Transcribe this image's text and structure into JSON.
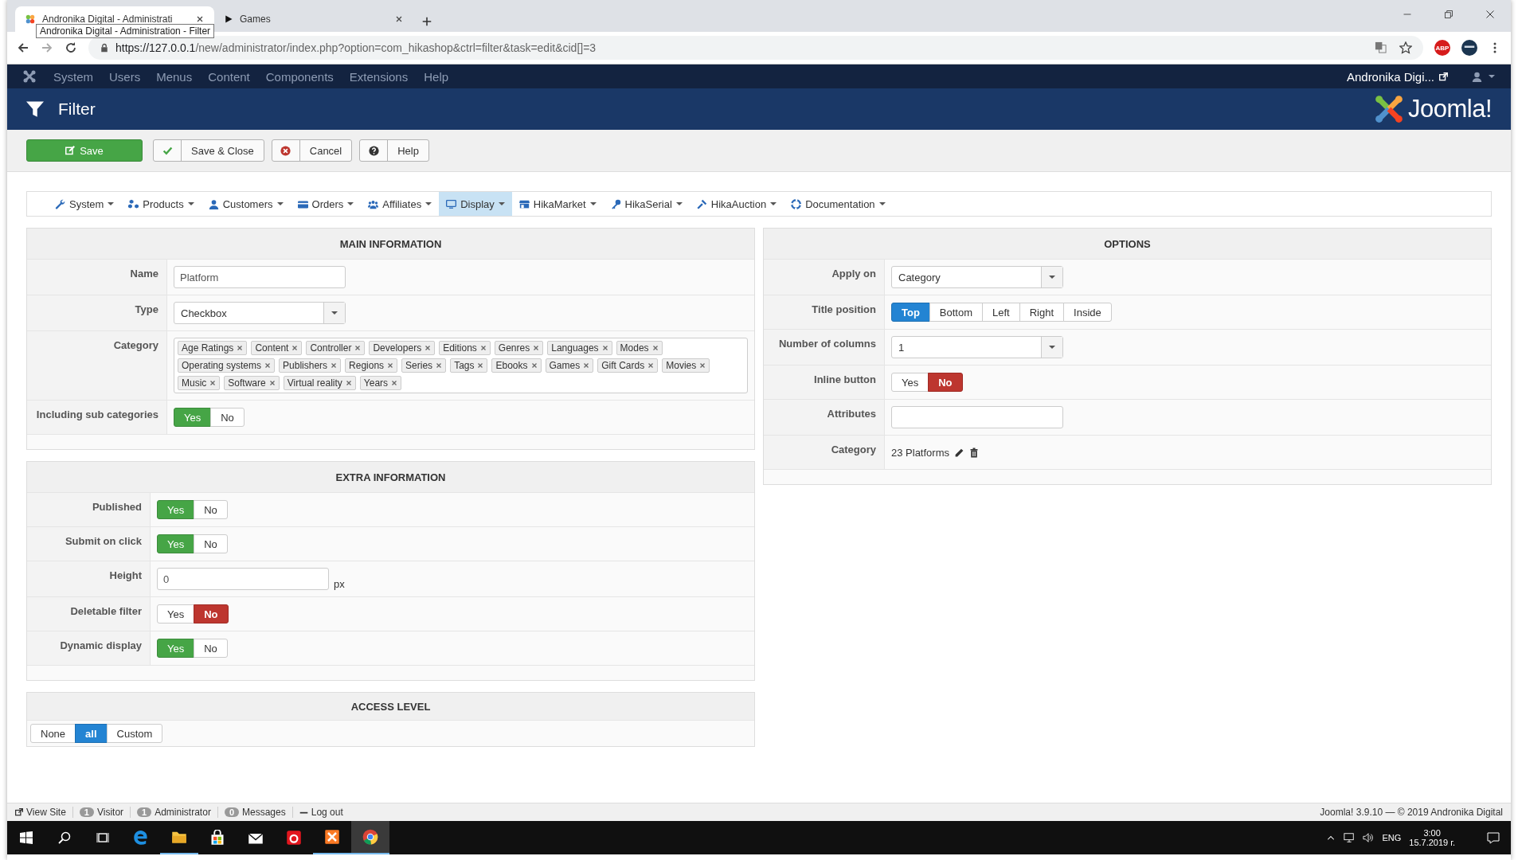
{
  "browser": {
    "tabs": [
      {
        "title": "Andronika Digital - Administrati",
        "selected": true,
        "kind": "site"
      },
      {
        "title": "Games",
        "selected": false,
        "kind": "media"
      }
    ],
    "tooltip": "Andronika Digital - Administration - Filter",
    "extension_badge": "ABP",
    "url_host": "https://127.0.0.1",
    "url_path": "/new/administrator/index.php?option=com_hikashop&ctrl=filter&task=edit&cid[]=3"
  },
  "admin_menu": {
    "items": [
      "System",
      "Users",
      "Menus",
      "Content",
      "Components",
      "Extensions",
      "Help"
    ],
    "site_link": "Andronika Digi..."
  },
  "header": {
    "title": "Filter",
    "logo_text": "Joomla!"
  },
  "toolbar": [
    {
      "label": "Save",
      "kind": "save"
    },
    {
      "label": "Save & Close",
      "kind": "check"
    },
    {
      "label": "Cancel",
      "kind": "cancel"
    },
    {
      "label": "Help",
      "kind": "help"
    }
  ],
  "submenu": [
    {
      "label": "System",
      "kind": "wrench",
      "selected": false
    },
    {
      "label": "Products",
      "kind": "cubes",
      "selected": false
    },
    {
      "label": "Customers",
      "kind": "user",
      "selected": false
    },
    {
      "label": "Orders",
      "kind": "card",
      "selected": false
    },
    {
      "label": "Affiliates",
      "kind": "users",
      "selected": false
    },
    {
      "label": "Display",
      "kind": "monitor",
      "selected": true
    },
    {
      "label": "HikaMarket",
      "kind": "store",
      "selected": false
    },
    {
      "label": "HikaSerial",
      "kind": "key",
      "selected": false
    },
    {
      "label": "HikaAuction",
      "kind": "gavel",
      "selected": false
    },
    {
      "label": "Documentation",
      "kind": "lifebuoy",
      "selected": false
    }
  ],
  "main_information": {
    "title": "MAIN INFORMATION",
    "rows": [
      {
        "label": "Name",
        "kind": "text",
        "value": "Platform"
      },
      {
        "label": "Type",
        "kind": "select",
        "value": "Checkbox"
      },
      {
        "label": "Category",
        "kind": "tags",
        "tags": [
          "Age Ratings",
          "Content",
          "Controller",
          "Developers",
          "Editions",
          "Genres",
          "Languages",
          "Modes",
          "Operating systems",
          "Publishers",
          "Regions",
          "Series",
          "Tags",
          "Ebooks",
          "Games",
          "Gift Cards",
          "Movies",
          "Music",
          "Software",
          "Virtual reality",
          "Years"
        ]
      },
      {
        "label": "Including sub categories",
        "kind": "toggle",
        "options": [
          {
            "label": "Yes",
            "kind": "yes",
            "selected": true
          },
          {
            "label": "No",
            "kind": "no",
            "selected": false
          }
        ]
      }
    ]
  },
  "extra_information": {
    "title": "EXTRA INFORMATION",
    "rows": [
      {
        "label": "Published",
        "kind": "toggle",
        "options": [
          {
            "label": "Yes",
            "kind": "yes",
            "selected": true
          },
          {
            "label": "No",
            "kind": "no",
            "selected": false
          }
        ]
      },
      {
        "label": "Submit on click",
        "kind": "toggle",
        "options": [
          {
            "label": "Yes",
            "kind": "yes",
            "selected": true
          },
          {
            "label": "No",
            "kind": "no",
            "selected": false
          }
        ]
      },
      {
        "label": "Height",
        "kind": "text",
        "value": "0",
        "suffix": "px"
      },
      {
        "label": "Deletable filter",
        "kind": "toggle",
        "options": [
          {
            "label": "Yes",
            "kind": "yes",
            "selected": false
          },
          {
            "label": "No",
            "kind": "no",
            "selected": true
          }
        ]
      },
      {
        "label": "Dynamic display",
        "kind": "toggle",
        "options": [
          {
            "label": "Yes",
            "kind": "yes",
            "selected": true
          },
          {
            "label": "No",
            "kind": "no",
            "selected": false
          }
        ]
      }
    ]
  },
  "access_level": {
    "title": "ACCESS LEVEL",
    "options": [
      {
        "label": "None",
        "kind": "plain",
        "selected": false
      },
      {
        "label": "all",
        "kind": "plain",
        "selected": true
      },
      {
        "label": "Custom",
        "kind": "plain",
        "selected": false
      }
    ]
  },
  "options": {
    "title": "OPTIONS",
    "rows": [
      {
        "label": "Apply on",
        "kind": "select",
        "value": "Category"
      },
      {
        "label": "Title position",
        "kind": "toggle",
        "options": [
          {
            "label": "Top",
            "kind": "plain",
            "selected": true
          },
          {
            "label": "Bottom",
            "kind": "plain",
            "selected": false
          },
          {
            "label": "Left",
            "kind": "plain",
            "selected": false
          },
          {
            "label": "Right",
            "kind": "plain",
            "selected": false
          },
          {
            "label": "Inside",
            "kind": "plain",
            "selected": false
          }
        ]
      },
      {
        "label": "Number of columns",
        "kind": "select",
        "value": "1"
      },
      {
        "label": "Inline button",
        "kind": "toggle",
        "options": [
          {
            "label": "Yes",
            "kind": "yes",
            "selected": false
          },
          {
            "label": "No",
            "kind": "no",
            "selected": true
          }
        ]
      },
      {
        "label": "Attributes",
        "kind": "text"
      },
      {
        "label": "Category",
        "kind": "link",
        "value": "23 Platforms"
      }
    ]
  },
  "status_bar": {
    "items": [
      {
        "kind": "link",
        "label": "View Site"
      },
      {
        "kind": "count",
        "count": "1",
        "label": "Visitor"
      },
      {
        "kind": "count",
        "count": "1",
        "label": "Administrator"
      },
      {
        "kind": "count",
        "count": "0",
        "label": "Messages"
      },
      {
        "kind": "logout",
        "label": "Log out"
      }
    ],
    "right": "Joomla! 3.9.10  —  © 2019 Andronika Digital"
  },
  "taskbar": {
    "language": "ENG",
    "time": "3:00",
    "date": "15.7.2019 г."
  }
}
